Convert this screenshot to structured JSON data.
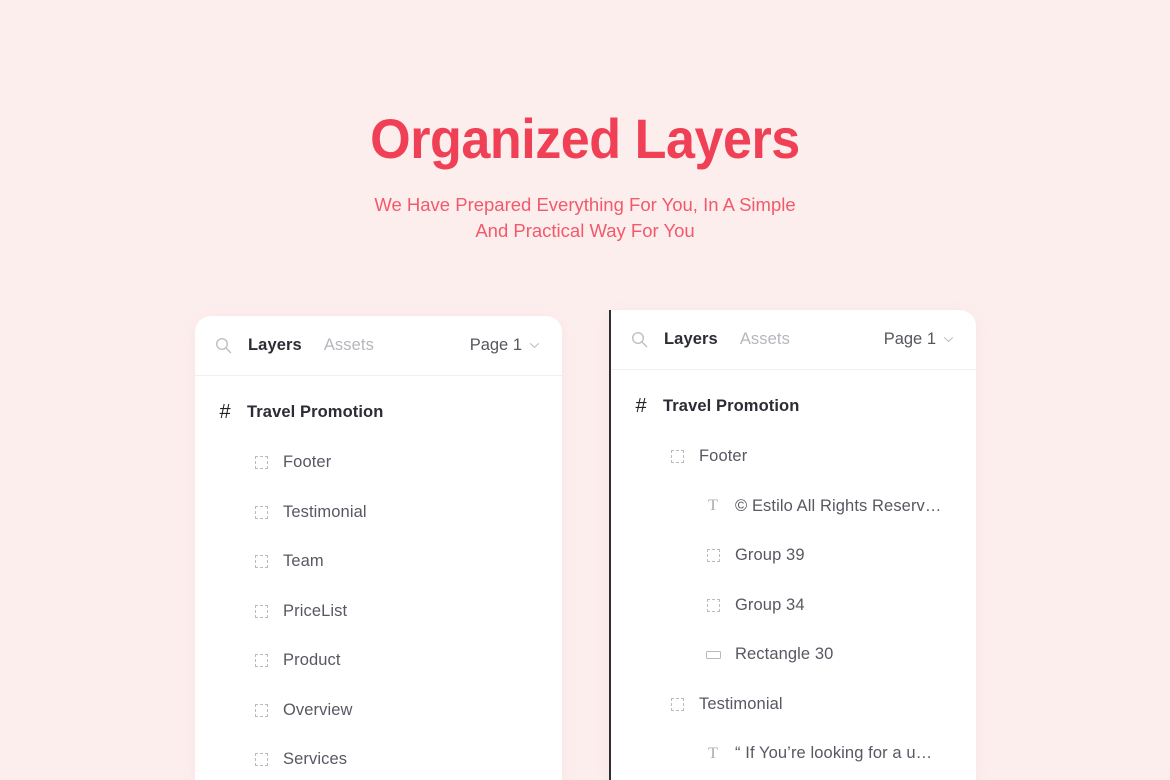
{
  "hero": {
    "title": "Organized Layers",
    "subtitle_line1": "We Have Prepared Everything For You, In A Simple",
    "subtitle_line2": "And Practical Way For You",
    "title_color": "#ef4056",
    "subtitle_color": "#f2596b",
    "background_color": "#fdeeee"
  },
  "panels": [
    {
      "id": "layers-panel-left",
      "header": {
        "search_icon": "search-icon",
        "tab_layers": "Layers",
        "tab_assets": "Assets",
        "page_label": "Page 1",
        "chevron_icon": "chevron-down-icon"
      },
      "rows": [
        {
          "icon": "hash-icon",
          "label": "Travel Promotion",
          "depth": 0,
          "root": true
        },
        {
          "icon": "frame-icon",
          "label": "Footer",
          "depth": 1,
          "root": false
        },
        {
          "icon": "frame-icon",
          "label": "Testimonial",
          "depth": 1,
          "root": false
        },
        {
          "icon": "frame-icon",
          "label": "Team",
          "depth": 1,
          "root": false
        },
        {
          "icon": "frame-icon",
          "label": "PriceList",
          "depth": 1,
          "root": false
        },
        {
          "icon": "frame-icon",
          "label": "Product",
          "depth": 1,
          "root": false
        },
        {
          "icon": "frame-icon",
          "label": "Overview",
          "depth": 1,
          "root": false
        },
        {
          "icon": "frame-icon",
          "label": "Services",
          "depth": 1,
          "root": false
        }
      ]
    },
    {
      "id": "layers-panel-right",
      "header": {
        "search_icon": "search-icon",
        "tab_layers": "Layers",
        "tab_assets": "Assets",
        "page_label": "Page 1",
        "chevron_icon": "chevron-down-icon"
      },
      "rows": [
        {
          "icon": "hash-icon",
          "label": "Travel Promotion",
          "depth": 0,
          "root": true
        },
        {
          "icon": "frame-icon",
          "label": "Footer",
          "depth": 1,
          "root": false
        },
        {
          "icon": "text-icon",
          "label": "© Estilo All Rights Reserv…",
          "depth": 2,
          "root": false
        },
        {
          "icon": "frame-icon",
          "label": "Group 39",
          "depth": 2,
          "root": false
        },
        {
          "icon": "frame-icon",
          "label": "Group 34",
          "depth": 2,
          "root": false
        },
        {
          "icon": "rect-icon",
          "label": "Rectangle 30",
          "depth": 2,
          "root": false
        },
        {
          "icon": "frame-icon",
          "label": "Testimonial",
          "depth": 1,
          "root": false
        },
        {
          "icon": "text-icon",
          "label": "“ If You’re looking for a u…",
          "depth": 2,
          "root": false
        }
      ]
    }
  ]
}
